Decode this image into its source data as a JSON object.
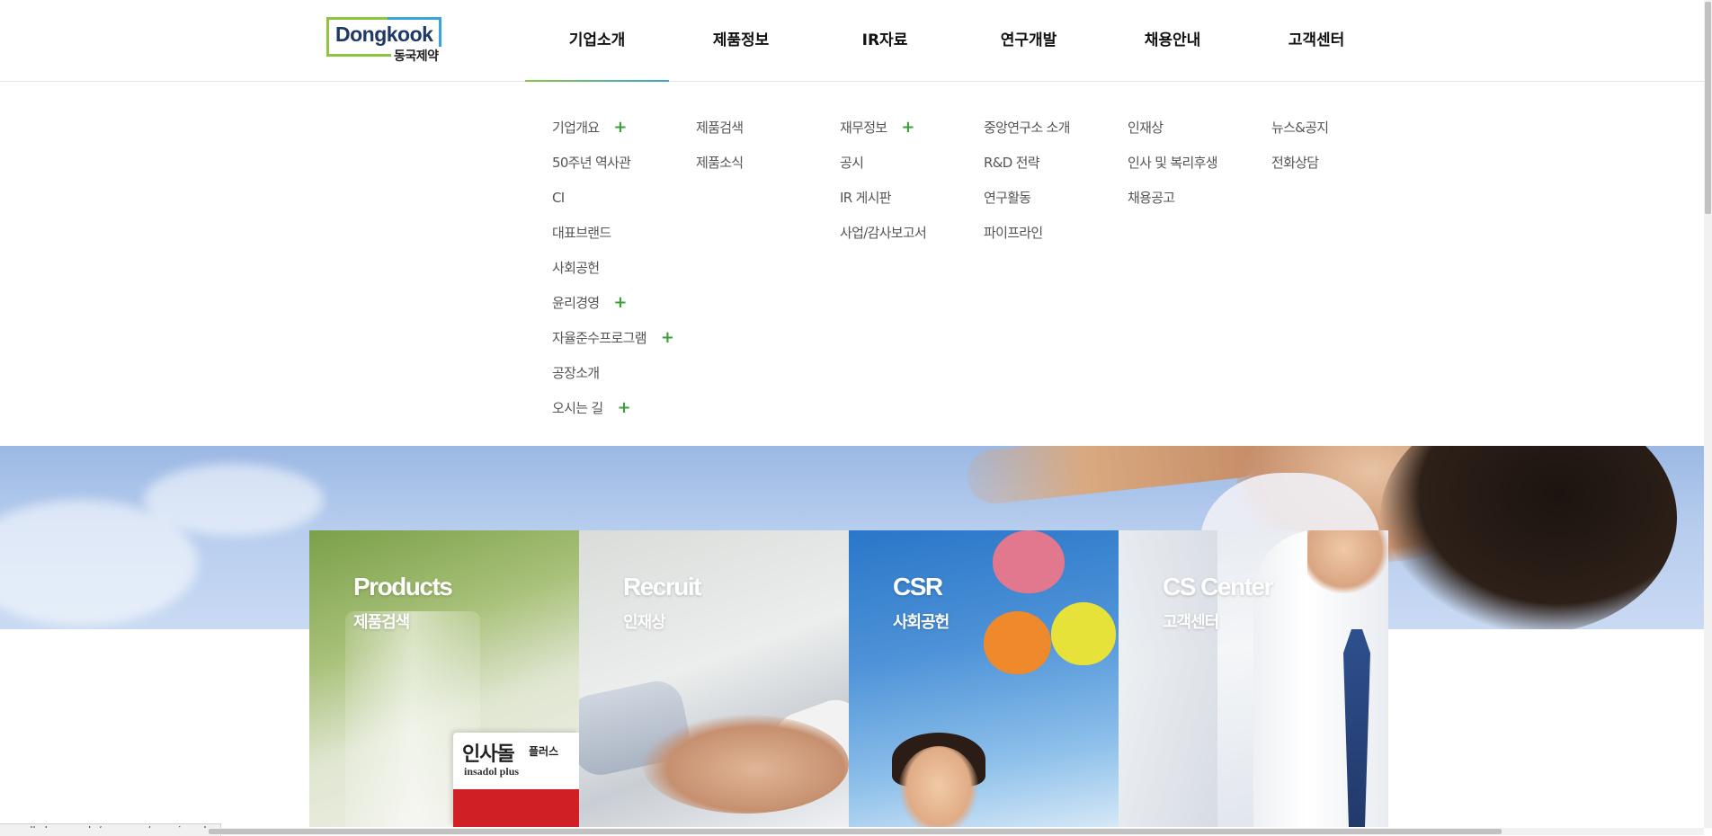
{
  "logo": {
    "en": "Dongkook",
    "ko": "동국제약"
  },
  "nav": [
    {
      "label": "기업소개",
      "active": true
    },
    {
      "label": "제품정보",
      "active": false
    },
    {
      "label": "IR자료",
      "active": false
    },
    {
      "label": "연구개발",
      "active": false
    },
    {
      "label": "채용안내",
      "active": false
    },
    {
      "label": "고객센터",
      "active": false
    }
  ],
  "submenu": {
    "company": [
      {
        "label": "기업개요",
        "expandable": true
      },
      {
        "label": "50주년 역사관",
        "expandable": false
      },
      {
        "label": "CI",
        "expandable": false
      },
      {
        "label": "대표브랜드",
        "expandable": false
      },
      {
        "label": "사회공헌",
        "expandable": false
      },
      {
        "label": "윤리경영",
        "expandable": true
      },
      {
        "label": "자율준수프로그램",
        "expandable": true
      },
      {
        "label": "공장소개",
        "expandable": false
      },
      {
        "label": "오시는 길",
        "expandable": true
      }
    ],
    "products": [
      {
        "label": "제품검색"
      },
      {
        "label": "제품소식"
      }
    ],
    "ir": [
      {
        "label": "재무정보",
        "expandable": true
      },
      {
        "label": "공시"
      },
      {
        "label": "IR 게시판"
      },
      {
        "label": "사업/감사보고서"
      }
    ],
    "rnd": [
      {
        "label": "중앙연구소 소개"
      },
      {
        "label": "R&D 전략"
      },
      {
        "label": "연구활동"
      },
      {
        "label": "파이프라인"
      }
    ],
    "recruit": [
      {
        "label": "인재상"
      },
      {
        "label": "인사 및 복리후생"
      },
      {
        "label": "채용공고"
      }
    ],
    "customer": [
      {
        "label": "뉴스&공지"
      },
      {
        "label": "전화상담"
      }
    ],
    "plus_symbol": "+"
  },
  "cards": [
    {
      "title": "Products",
      "subtitle": "제품검색"
    },
    {
      "title": "Recruit",
      "subtitle": "인재상"
    },
    {
      "title": "CSR",
      "subtitle": "사회공헌"
    },
    {
      "title": "CS Center",
      "subtitle": "고객센터"
    }
  ],
  "product_box": {
    "name": "인사돌",
    "suffix": "플러스",
    "en": "insadol plus"
  },
  "status_url": "www.dkpharm.co.kr/company/overview.php",
  "colors": {
    "accent_green": "#8cc63f",
    "accent_blue": "#3aa6d8",
    "plus_green": "#3aa03a"
  },
  "icons": {
    "expand": "plus-icon"
  }
}
